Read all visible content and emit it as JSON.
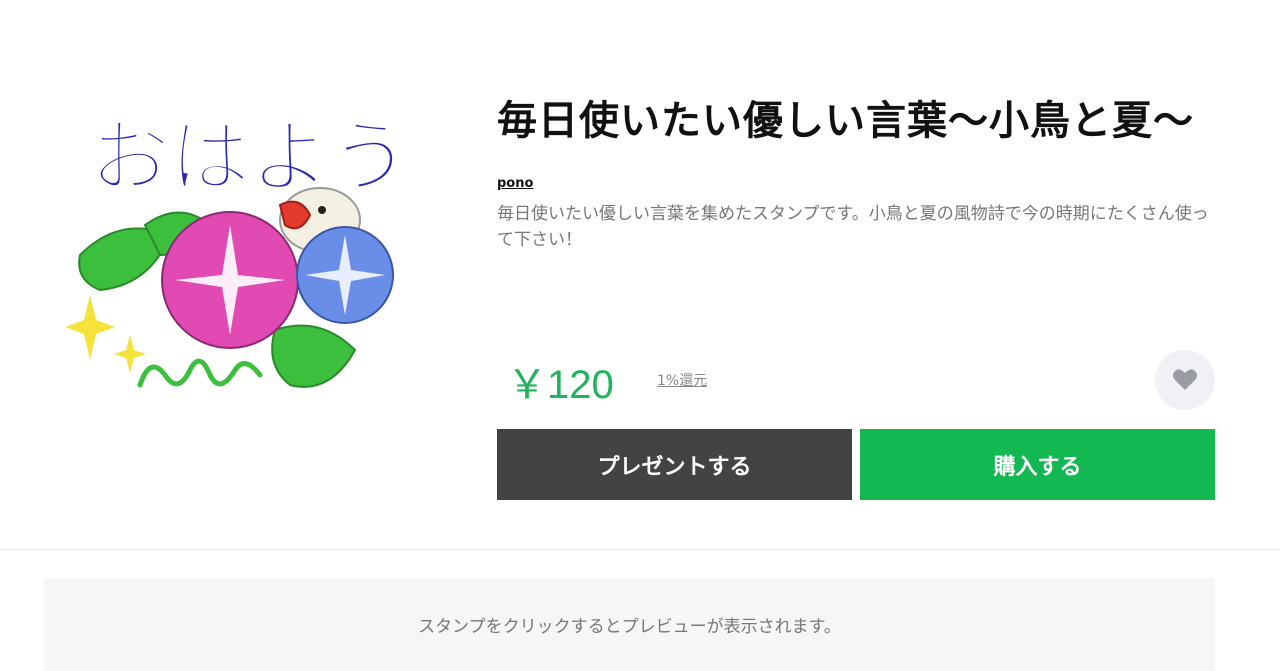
{
  "sticker": {
    "text": "おはよう",
    "icon": "sticker-morning-glory-bird"
  },
  "product": {
    "title": "毎日使いたい優しい言葉〜小鳥と夏〜",
    "author": "pono",
    "description": "毎日使いたい優しい言葉を集めたスタンプです。小鳥と夏の風物詩で今の時期にたくさん使って下さい！",
    "price": "￥120",
    "cashback": "1%還元"
  },
  "actions": {
    "gift_label": "プレゼントする",
    "buy_label": "購入する",
    "favorite_icon": "heart-icon"
  },
  "preview": {
    "note": "スタンプをクリックするとプレビューが表示されます。"
  },
  "colors": {
    "price": "#1fb45a",
    "gift_button": "#434343",
    "buy_button": "#14b853",
    "sticker_text": "#2a2bb0"
  }
}
